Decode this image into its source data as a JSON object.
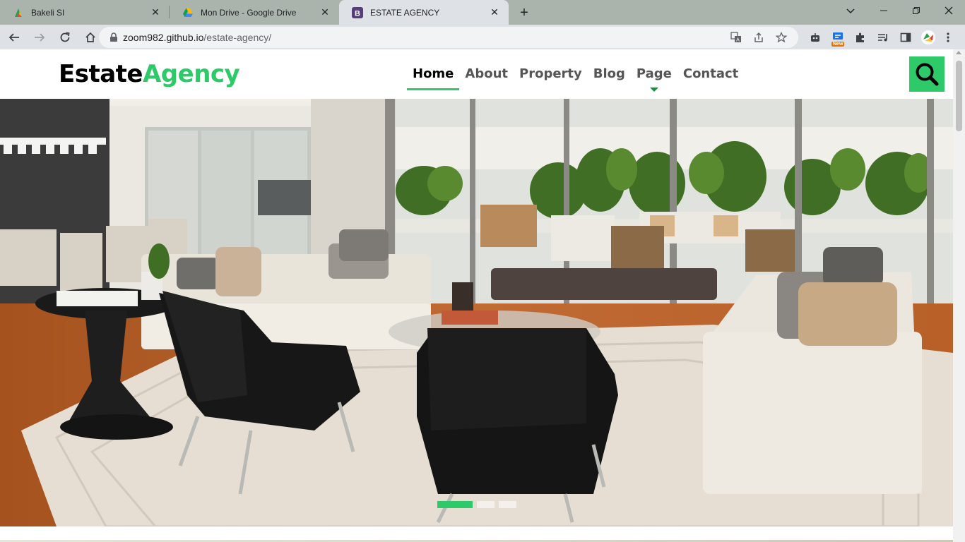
{
  "browser": {
    "tabs": [
      {
        "title": "Bakeli SI",
        "active": false,
        "favicon": "bakeli-logo-icon"
      },
      {
        "title": "Mon Drive - Google Drive",
        "active": false,
        "favicon": "google-drive-icon"
      },
      {
        "title": "ESTATE AGENCY",
        "active": true,
        "favicon": "bootstrap-b-icon",
        "favicon_letter": "B"
      }
    ],
    "url_host": "zoom982.github.io",
    "url_path": "/estate-agency/",
    "new_badge": "New",
    "colors": {
      "tabbar": "#aab4ad",
      "toolbar": "#dee1e6"
    }
  },
  "site": {
    "logo_part1": "Estate",
    "logo_part2": "Agency",
    "menu": [
      {
        "label": "Home",
        "active": true
      },
      {
        "label": "About",
        "active": false
      },
      {
        "label": "Property",
        "active": false
      },
      {
        "label": "Blog",
        "active": false
      },
      {
        "label": "Page",
        "active": false,
        "dropdown": true
      },
      {
        "label": "Contact",
        "active": false
      }
    ],
    "search_icon": "search-icon",
    "accent_color": "#2eca6a"
  },
  "hero": {
    "image": "modern living room with sofas, black armchairs and patio with plants",
    "carousel_slides": 3,
    "active_slide": 1
  }
}
